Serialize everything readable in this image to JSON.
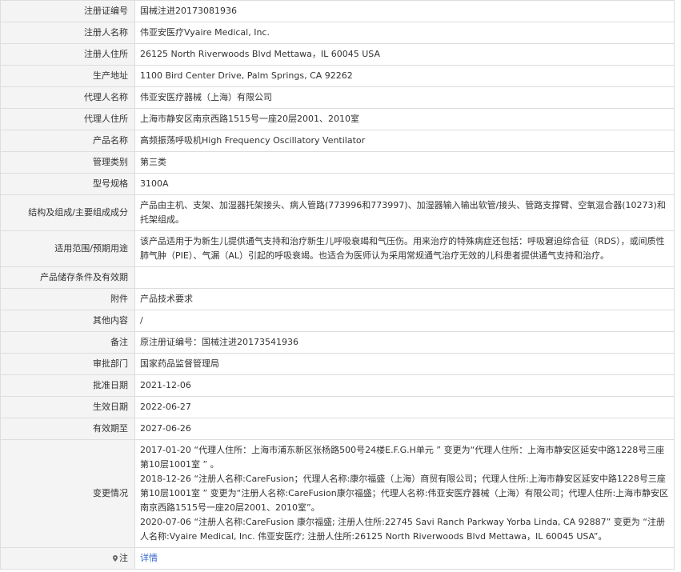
{
  "rows": [
    {
      "label": "注册证编号",
      "value": "国械注进20173081936"
    },
    {
      "label": "注册人名称",
      "value": "伟亚安医疗Vyaire Medical, Inc."
    },
    {
      "label": "注册人住所",
      "value": "26125 North Riverwoods Blvd Mettawa，IL 60045 USA"
    },
    {
      "label": "生产地址",
      "value": "1100 Bird Center Drive, Palm Springs, CA 92262"
    },
    {
      "label": "代理人名称",
      "value": "伟亚安医疗器械（上海）有限公司"
    },
    {
      "label": "代理人住所",
      "value": "上海市静安区南京西路1515号一座20层2001、2010室"
    },
    {
      "label": "产品名称",
      "value": "高频振荡呼吸机High Frequency Oscillatory Ventilator"
    },
    {
      "label": "管理类别",
      "value": "第三类"
    },
    {
      "label": "型号规格",
      "value": "3100A"
    },
    {
      "label": "结构及组成/主要组成成分",
      "value": "产品由主机、支架、加湿器托架接头、病人管路(773996和773997)、加湿器输入输出软管/接头、管路支撑臂、空氧混合器(10273)和托架组成。"
    },
    {
      "label": "适用范围/预期用途",
      "value": "该产品适用于为新生儿提供通气支持和治疗新生儿呼吸衰竭和气压伤。用来治疗的特殊病症还包括：呼吸窘迫综合征（RDS），或间质性肺气肿（PIE）、气漏（AL）引起的呼吸衰竭。也适合为医师认为采用常规通气治疗无效的儿科患者提供通气支持和治疗。"
    },
    {
      "label": "产品储存条件及有效期",
      "value": ""
    },
    {
      "label": "附件",
      "value": "产品技术要求"
    },
    {
      "label": "其他内容",
      "value": "/"
    },
    {
      "label": "备注",
      "value": "原注册证编号：国械注进20173541936"
    },
    {
      "label": "审批部门",
      "value": "国家药品监督管理局"
    },
    {
      "label": "批准日期",
      "value": "2021-12-06"
    },
    {
      "label": "生效日期",
      "value": "2022-06-27"
    },
    {
      "label": "有效期至",
      "value": "2027-06-26"
    }
  ],
  "changes": {
    "label": "变更情况",
    "entries": [
      "2017-01-20 “代理人住所：上海市浦东新区张杨路500号24楼E.F.G.H单元 ” 变更为“代理人住所：上海市静安区延安中路1228号三座第10层1001室 ” 。",
      "2018-12-26 “注册人名称:CareFusion；代理人名称:康尔福盛（上海）商贸有限公司；代理人住所:上海市静安区延安中路1228号三座第10层1001室 ” 变更为“注册人名称:CareFusion康尔福盛；代理人名称:伟亚安医疗器械（上海）有限公司；代理人住所:上海市静安区南京西路1515号一座20层2001、2010室”。",
      "2020-07-06 “注册人名称:CareFusion 康尔福盛; 注册人住所:22745 Savi Ranch Parkway Yorba Linda, CA 92887” 变更为 “注册人名称:Vyaire Medical, Inc. 伟亚安医疗; 注册人住所:26125 North Riverwoods Blvd Mettawa，IL 60045 USA”。"
    ]
  },
  "note": {
    "icon": "pin-icon",
    "label": "注",
    "link_text": "详情",
    "icon_color": "#666666",
    "link_color": "#3366cc"
  },
  "colors": {
    "label_bg": "#f4f4f4",
    "border": "#dddddd",
    "text": "#333333"
  }
}
